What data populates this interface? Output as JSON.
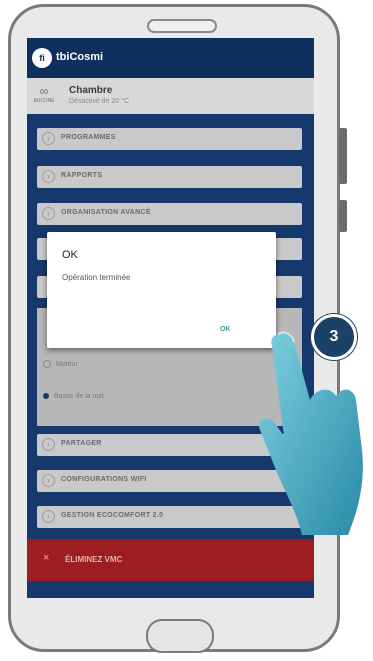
{
  "app": {
    "logo": "fi",
    "name": "tbiCosmi"
  },
  "room": {
    "icon_label": "AUCUNE",
    "name": "Chambre",
    "status": "Désactivé de 20 °C"
  },
  "menu": {
    "programmes": "PROGRAMMES",
    "rapports": "RAPPORTS",
    "organisation": "ORGANISATION AVANCÉ",
    "partager": "PARTAGER",
    "configurations": "CONFIGURATIONS WIFI",
    "gestion": "GESTION ECOCOMFORT 2.0"
  },
  "options": {
    "option_1": "Moteur",
    "option_2": "Basse de la nuit"
  },
  "dialog": {
    "title": "OK",
    "message": "Opération terminée",
    "ok_button": "OK"
  },
  "delete": {
    "icon": "×",
    "label": "ÉLIMINEZ VMC"
  },
  "step_badge": "3"
}
